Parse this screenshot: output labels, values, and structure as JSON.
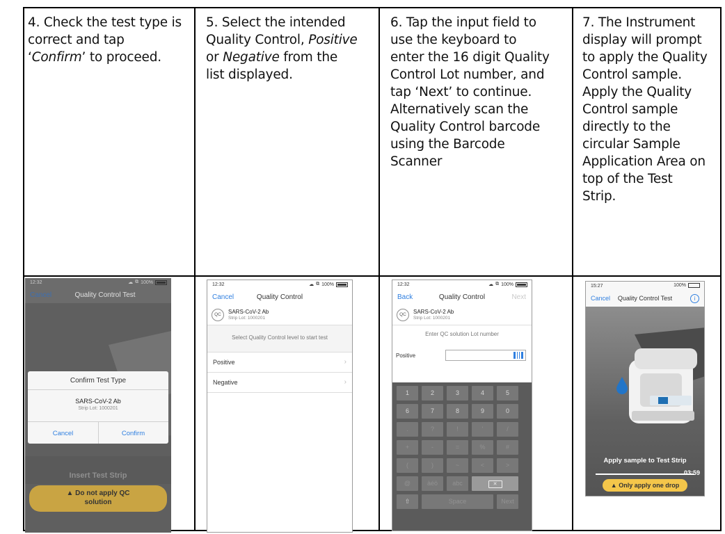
{
  "steps": [
    {
      "line1": "4. Check the test type is",
      "line2": "correct and tap",
      "line3_pre": "‘",
      "line3_em": "Confirm",
      "line3_post": "’ to proceed."
    },
    {
      "line1": "5. Select the intended",
      "line2_pre": "Quality Control, ",
      "line2_em": "Positive",
      "line3_pre": "or ",
      "line3_em": "Negative",
      "line3_post": " from the",
      "line4": "list displayed."
    },
    {
      "lines": [
        "6. Tap the input field to",
        "use the keyboard to",
        "enter the 16 digit Quality",
        "Control Lot number, and",
        "tap ‘Next’ to continue.",
        "Alternatively scan the",
        "Quality Control barcode",
        "using the Barcode",
        "Scanner"
      ]
    },
    {
      "lines": [
        "7. The Instrument",
        "display will prompt",
        "to apply the Quality",
        "Control sample.",
        "Apply the Quality",
        "Control sample",
        "directly to the",
        "circular Sample",
        "Application Area on",
        "top of the Test",
        "Strip."
      ]
    }
  ],
  "screen1": {
    "time": "12:32",
    "battery": "100%",
    "cancel": "Cancel",
    "title": "Quality Control Test",
    "dialog_title": "Confirm Test Type",
    "test_name": "SARS-CoV-2 Ab",
    "strip_lot": "Strip Lot: 1000201",
    "cancel_btn": "Cancel",
    "confirm_btn": "Confirm",
    "insert": "Insert Test Strip",
    "warning_line1": "Do not apply QC",
    "warning_line2": "solution"
  },
  "screen2": {
    "time": "12:32",
    "battery": "100%",
    "cancel": "Cancel",
    "title": "Quality Control",
    "badge": "QC",
    "test_name": "SARS-CoV-2 Ab",
    "strip_lot": "Strip Lot: 1000201",
    "hint": "Select Quality Control level to start test",
    "options": [
      "Positive",
      "Negative"
    ]
  },
  "screen3": {
    "time": "12:32",
    "battery": "100%",
    "back": "Back",
    "title": "Quality Control",
    "next": "Next",
    "badge": "QC",
    "test_name": "SARS-CoV-2 Ab",
    "strip_lot": "Strip Lot: 1000201",
    "hint": "Enter QC solution Lot number",
    "field_label": "Positive",
    "field_value": "",
    "keys_row1": [
      "1",
      "2",
      "3",
      "4",
      "5"
    ],
    "keys_row2": [
      "6",
      "7",
      "8",
      "9",
      "0"
    ],
    "keys_row3": [
      ".",
      "?",
      "!",
      "'",
      "/"
    ],
    "keys_row4": [
      "+",
      "-",
      "=",
      "%",
      "#"
    ],
    "keys_row5": [
      "(",
      ")",
      "~",
      "<",
      ">"
    ],
    "keys_row6": [
      "@",
      "àéö",
      "abc"
    ],
    "space": "Space",
    "next_key": "Next"
  },
  "screen4": {
    "time": "15:27",
    "battery": "100%",
    "cancel": "Cancel",
    "title": "Quality Control Test",
    "apply": "Apply sample to Test Strip",
    "timer": "03:59",
    "warning": "Only apply one drop"
  },
  "colors": {
    "ios_blue": "#2f7fe0",
    "warning_yellow": "#f4c64a",
    "dark_overlay": "#5f5f5f",
    "keyboard": "#5b5b5b"
  }
}
